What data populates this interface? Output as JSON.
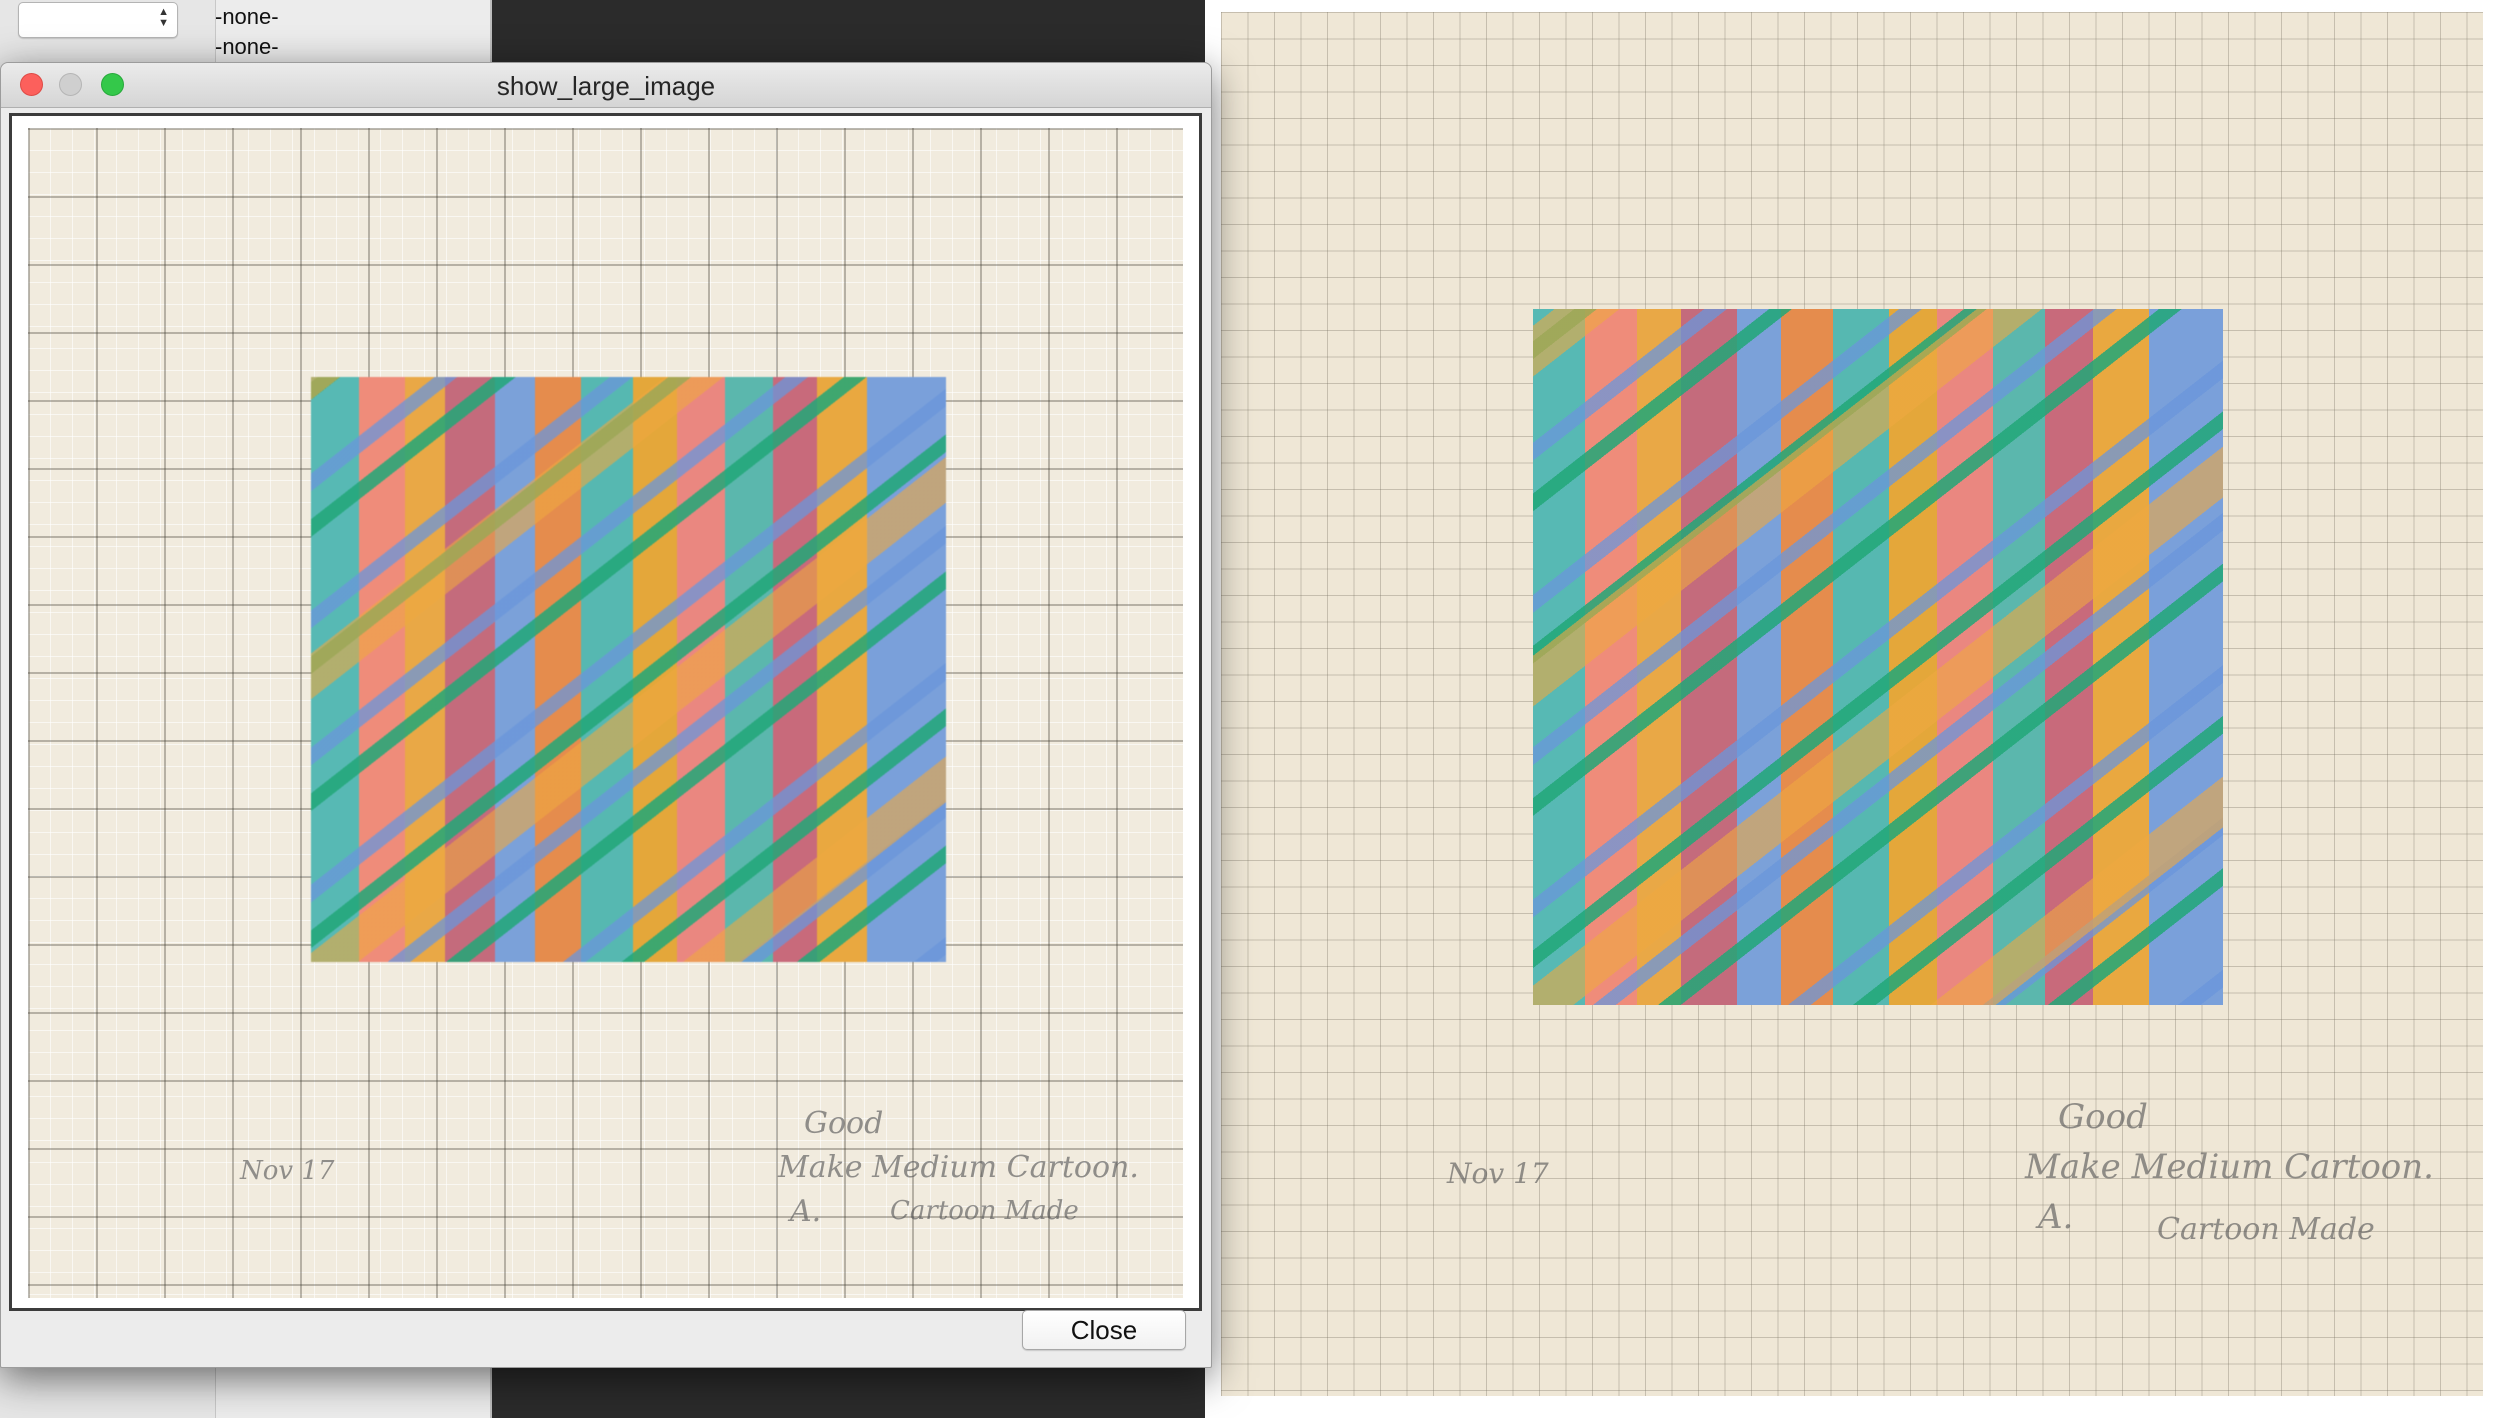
{
  "background_app": {
    "select_value": "",
    "list_items": [
      "-none-",
      "-none-"
    ]
  },
  "dialog": {
    "title": "show_large_image",
    "close_button_label": "Close"
  },
  "artwork": {
    "annotations": {
      "good": "Good",
      "make": "Make Medium Cartoon.",
      "letter": "A.",
      "date": "Nov 17",
      "signature": "Cartoon Made"
    }
  },
  "colors": {
    "turquoise": "#57b9b4",
    "salmon": "#ef8c7a",
    "orange": "#e9a846",
    "rose": "#c46b7c",
    "blue": "#7ba1d9",
    "green": "#21a778",
    "paper": "#efe7d6"
  }
}
